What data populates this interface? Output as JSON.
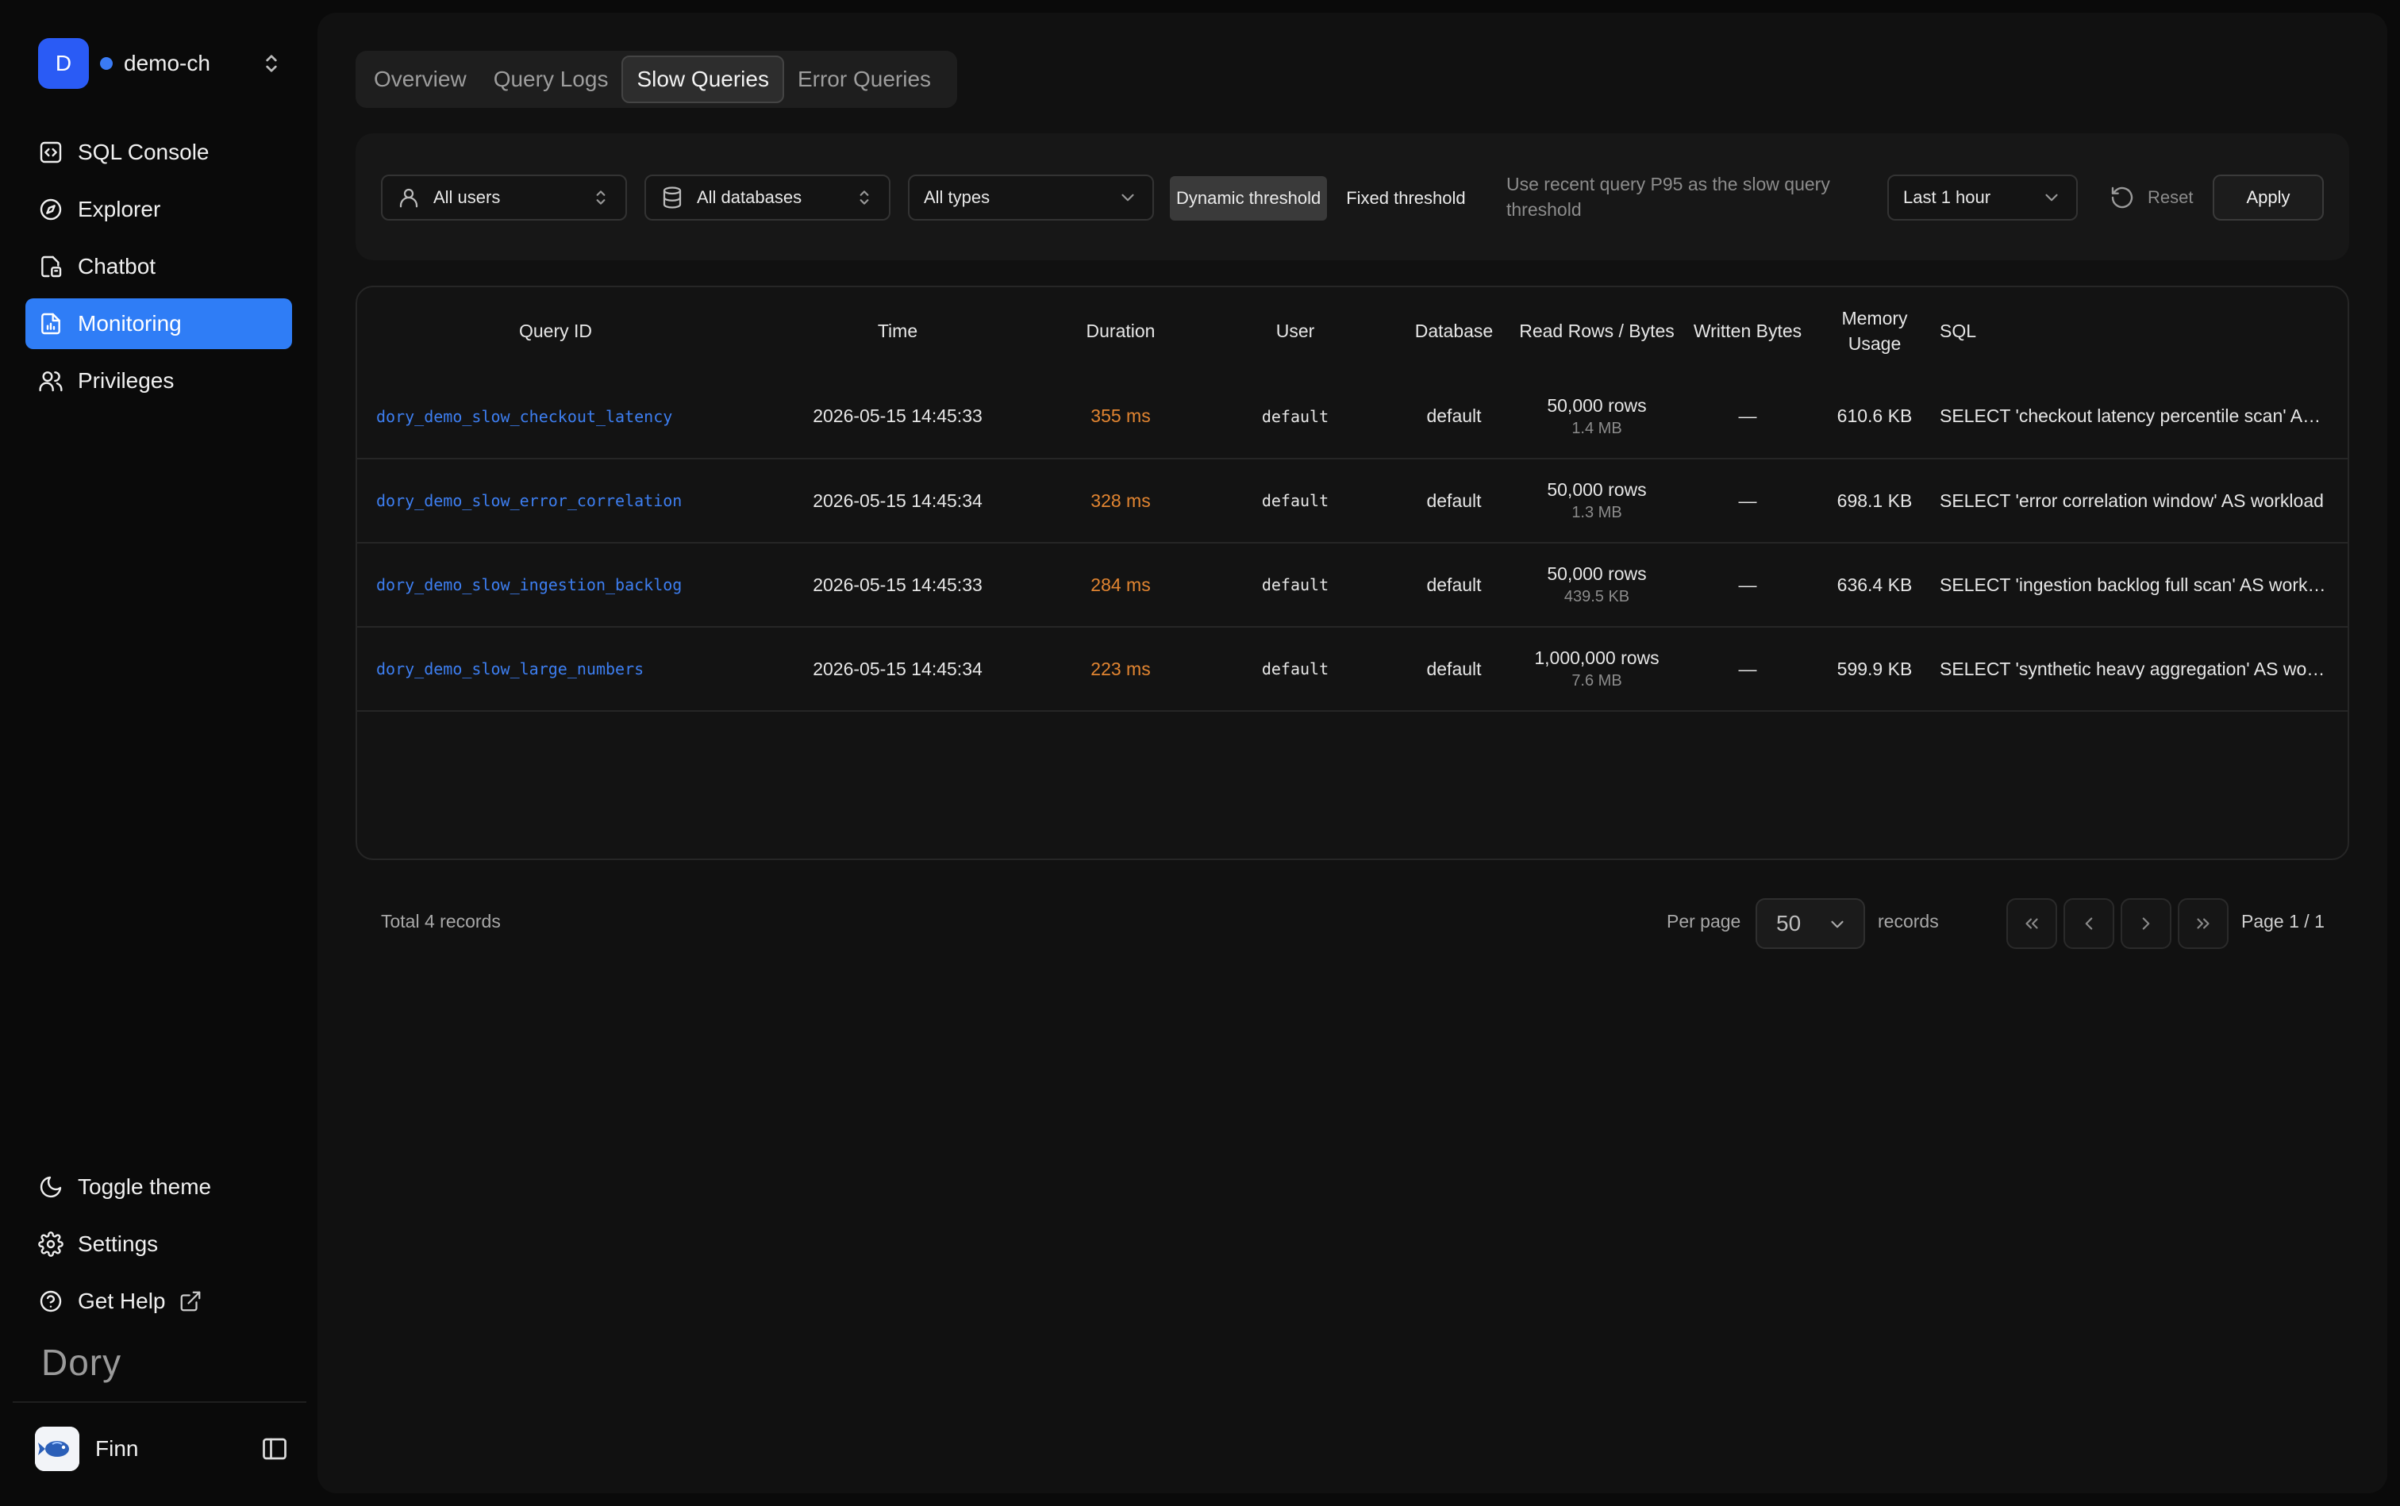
{
  "connection": {
    "avatar_letter": "D",
    "name": "demo-ch",
    "status_color": "#3a7bf5"
  },
  "sidebar": {
    "items": [
      {
        "label": "SQL Console",
        "icon": "code-window-icon"
      },
      {
        "label": "Explorer",
        "icon": "compass-icon"
      },
      {
        "label": "Chatbot",
        "icon": "chat-document-icon"
      },
      {
        "label": "Monitoring",
        "icon": "monitor-document-icon",
        "active": true
      },
      {
        "label": "Privileges",
        "icon": "users-icon"
      }
    ],
    "bottom": [
      {
        "label": "Toggle theme",
        "icon": "moon-icon"
      },
      {
        "label": "Settings",
        "icon": "gear-icon"
      },
      {
        "label": "Get Help",
        "icon": "help-circle-icon"
      }
    ],
    "brand": "Dory",
    "user": {
      "name": "Finn"
    }
  },
  "tabs": [
    {
      "label": "Overview"
    },
    {
      "label": "Query Logs"
    },
    {
      "label": "Slow Queries",
      "active": true
    },
    {
      "label": "Error Queries"
    }
  ],
  "filters": {
    "users": "All users",
    "databases": "All databases",
    "types": "All types",
    "threshold_dynamic": "Dynamic threshold",
    "threshold_fixed": "Fixed threshold",
    "threshold_mode": "dynamic",
    "hint": "Use recent query P95 as the slow query threshold",
    "time_range": "Last 1 hour",
    "reset": "Reset",
    "apply": "Apply"
  },
  "table": {
    "headers": {
      "query_id": "Query ID",
      "time": "Time",
      "duration": "Duration",
      "user": "User",
      "database": "Database",
      "read": "Read Rows / Bytes",
      "written": "Written Bytes",
      "memory": "Memory Usage",
      "sql": "SQL"
    },
    "rows": [
      {
        "query_id": "dory_demo_slow_checkout_latency",
        "time": "2026-05-15 14:45:33",
        "duration": "355 ms",
        "user": "default",
        "database": "default",
        "read_rows": "50,000 rows",
        "read_bytes": "1.4 MB",
        "written": "—",
        "memory": "610.6 KB",
        "sql": "SELECT 'checkout latency percentile scan' AS workload"
      },
      {
        "query_id": "dory_demo_slow_error_correlation",
        "time": "2026-05-15 14:45:34",
        "duration": "328 ms",
        "user": "default",
        "database": "default",
        "read_rows": "50,000 rows",
        "read_bytes": "1.3 MB",
        "written": "—",
        "memory": "698.1 KB",
        "sql": "SELECT 'error correlation window' AS workload"
      },
      {
        "query_id": "dory_demo_slow_ingestion_backlog",
        "time": "2026-05-15 14:45:33",
        "duration": "284 ms",
        "user": "default",
        "database": "default",
        "read_rows": "50,000 rows",
        "read_bytes": "439.5 KB",
        "written": "—",
        "memory": "636.4 KB",
        "sql": "SELECT 'ingestion backlog full scan' AS workload"
      },
      {
        "query_id": "dory_demo_slow_large_numbers",
        "time": "2026-05-15 14:45:34",
        "duration": "223 ms",
        "user": "default",
        "database": "default",
        "read_rows": "1,000,000 rows",
        "read_bytes": "7.6 MB",
        "written": "—",
        "memory": "599.9 KB",
        "sql": "SELECT 'synthetic heavy aggregation' AS workload"
      }
    ]
  },
  "footer": {
    "total": "Total 4 records",
    "per_page_label": "Per page",
    "per_page_value": "50",
    "records_label": "records",
    "page_info": "Page 1 / 1"
  },
  "colors": {
    "accent": "#2f7df6",
    "query_id_link": "#3d7ef0",
    "duration_warn": "#e28531"
  }
}
